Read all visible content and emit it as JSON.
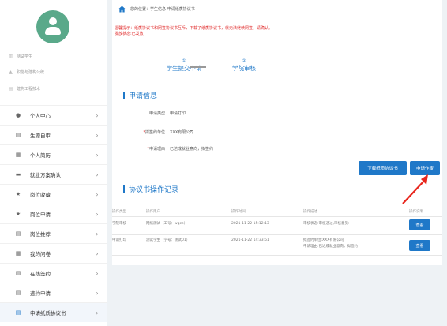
{
  "sidebar": {
    "info": [
      "测试学生",
      "职能与建构公统",
      "建构工程技术"
    ],
    "items": [
      {
        "label": "个人中心",
        "icon": "person-icon"
      },
      {
        "label": "生源自审",
        "icon": "id-card-icon"
      },
      {
        "label": "个人简历",
        "icon": "document-icon"
      },
      {
        "label": "就业方案确认",
        "icon": "briefcase-icon"
      },
      {
        "label": "岗位收藏",
        "icon": "star-icon"
      },
      {
        "label": "岗位申请",
        "icon": "star-icon"
      },
      {
        "label": "岗位推荐",
        "icon": "id-card-icon"
      },
      {
        "label": "我的问卷",
        "icon": "document-icon"
      },
      {
        "label": "在线签约",
        "icon": "id-card-icon"
      },
      {
        "label": "违约申请",
        "icon": "id-card-icon"
      },
      {
        "label": "申请纸质协议书",
        "icon": "id-card-icon"
      }
    ]
  },
  "breadcrumb": "您的位置：学生信息-申请纸质协议书",
  "warning": {
    "line1": "温馨提示：纸质协议书和网签协议书互斥，下载了纸质协议书，就无法继续网签，请确认。",
    "line2": "发放状态:已发放"
  },
  "steps": [
    {
      "num": "①",
      "label": "学生提交申请"
    },
    {
      "num": "②",
      "label": "学院审核"
    }
  ],
  "apply_section": {
    "title": "申请信息",
    "fields": [
      {
        "label": "申请类型",
        "required": "",
        "value": "申请打印"
      },
      {
        "label": "拟签约单位",
        "required": "*",
        "value": "XXX有限公司"
      },
      {
        "label": "申请理由",
        "required": "*",
        "value": "已达成就业意向，拟签约"
      }
    ]
  },
  "buttons": {
    "download": "下载纸质协议书",
    "cancel": "申请作废"
  },
  "log_section": {
    "title": "协议书操作记录",
    "headers": [
      "操作类型",
      "操作用户",
      "操作时间",
      "操作描述",
      "操作说明"
    ],
    "rows": [
      {
        "type": "学院审核",
        "user": "网络测试（工号：wqce）",
        "time": "2021-11-22 15:12:13",
        "desc1": "审核状态:审核通过,审核意见:",
        "desc2": "",
        "action": "查看"
      },
      {
        "type": "申请打印",
        "user": "测试学生（学号：测试01）",
        "time": "2021-11-22 14:33:51",
        "desc1": "拟签约单位:XXX有限公司",
        "desc2": "申请理由:已达成就业意向，拟签约",
        "action": "查看"
      }
    ]
  },
  "colors": {
    "accent": "#1f78c8",
    "warning": "#e02828",
    "annotation": "#e8251c"
  }
}
